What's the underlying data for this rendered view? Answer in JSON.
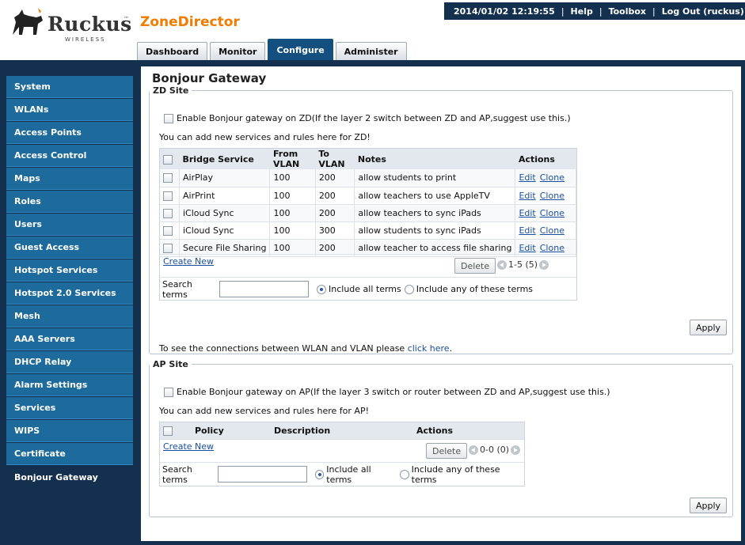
{
  "header": {
    "brand": "Ruckus",
    "brand_sub": "WIRELESS",
    "brand_tm": "™",
    "product": "ZoneDirector",
    "datetime": "2014/01/02 12:19:55",
    "links": {
      "help": "Help",
      "toolbox": "Toolbox",
      "logout": "Log Out (ruckus)"
    },
    "separator": "|"
  },
  "tabs": [
    {
      "label": "Dashboard",
      "active": false
    },
    {
      "label": "Monitor",
      "active": false
    },
    {
      "label": "Configure",
      "active": true
    },
    {
      "label": "Administer",
      "active": false
    }
  ],
  "sidebar": {
    "items": [
      {
        "label": "System"
      },
      {
        "label": "WLANs"
      },
      {
        "label": "Access Points"
      },
      {
        "label": "Access Control"
      },
      {
        "label": "Maps"
      },
      {
        "label": "Roles"
      },
      {
        "label": "Users"
      },
      {
        "label": "Guest Access"
      },
      {
        "label": "Hotspot Services"
      },
      {
        "label": "Hotspot 2.0 Services"
      },
      {
        "label": "Mesh"
      },
      {
        "label": "AAA Servers"
      },
      {
        "label": "DHCP Relay"
      },
      {
        "label": "Alarm Settings"
      },
      {
        "label": "Services"
      },
      {
        "label": "WIPS"
      },
      {
        "label": "Certificate"
      },
      {
        "label": "Bonjour Gateway",
        "active": true
      }
    ]
  },
  "page_title": "Bonjour Gateway",
  "zd_site": {
    "legend": "ZD Site",
    "enable_label": "Enable Bonjour gateway on ZD(If the layer 2 switch between ZD and AP,suggest use this.)",
    "note": "You can add new services and rules here for ZD!",
    "columns": [
      "Bridge Service",
      "From VLAN",
      "To VLAN",
      "Notes",
      "Actions"
    ],
    "rows": [
      {
        "service": "AirPlay",
        "from": "100",
        "to": "200",
        "notes": "allow students to print"
      },
      {
        "service": "AirPrint",
        "from": "100",
        "to": "200",
        "notes": "allow teachers to use AppleTV"
      },
      {
        "service": "iCloud Sync",
        "from": "100",
        "to": "200",
        "notes": "allow teachers to sync iPads"
      },
      {
        "service": "iCloud Sync",
        "from": "100",
        "to": "300",
        "notes": "allow students to sync iPads"
      },
      {
        "service": "Secure File Sharing",
        "from": "100",
        "to": "200",
        "notes": "allow teacher to access file sharing"
      }
    ],
    "edit_label": "Edit",
    "clone_label": "Clone",
    "create_new": "Create New",
    "delete_label": "Delete",
    "pager": "1-5 (5)",
    "search_label": "Search terms",
    "search_value": "",
    "opt_all": "Include all terms",
    "opt_any": "Include any of these terms",
    "apply_label": "Apply",
    "vlan_note_prefix": "To see the connections between WLAN and VLAN please ",
    "vlan_note_link": "click here",
    "vlan_note_suffix": "."
  },
  "ap_site": {
    "legend": "AP Site",
    "enable_label": "Enable Bonjour gateway on AP(If the layer 3 switch or router between ZD and AP,suggest use this.)",
    "note": "You can add new services and rules here for AP!",
    "columns": [
      "Policy",
      "Description",
      "Actions"
    ],
    "create_new": "Create New",
    "delete_label": "Delete",
    "pager": "0-0 (0)",
    "search_label": "Search terms",
    "search_value": "",
    "opt_all": "Include all terms",
    "opt_any": "Include any of these terms",
    "apply_label": "Apply"
  }
}
